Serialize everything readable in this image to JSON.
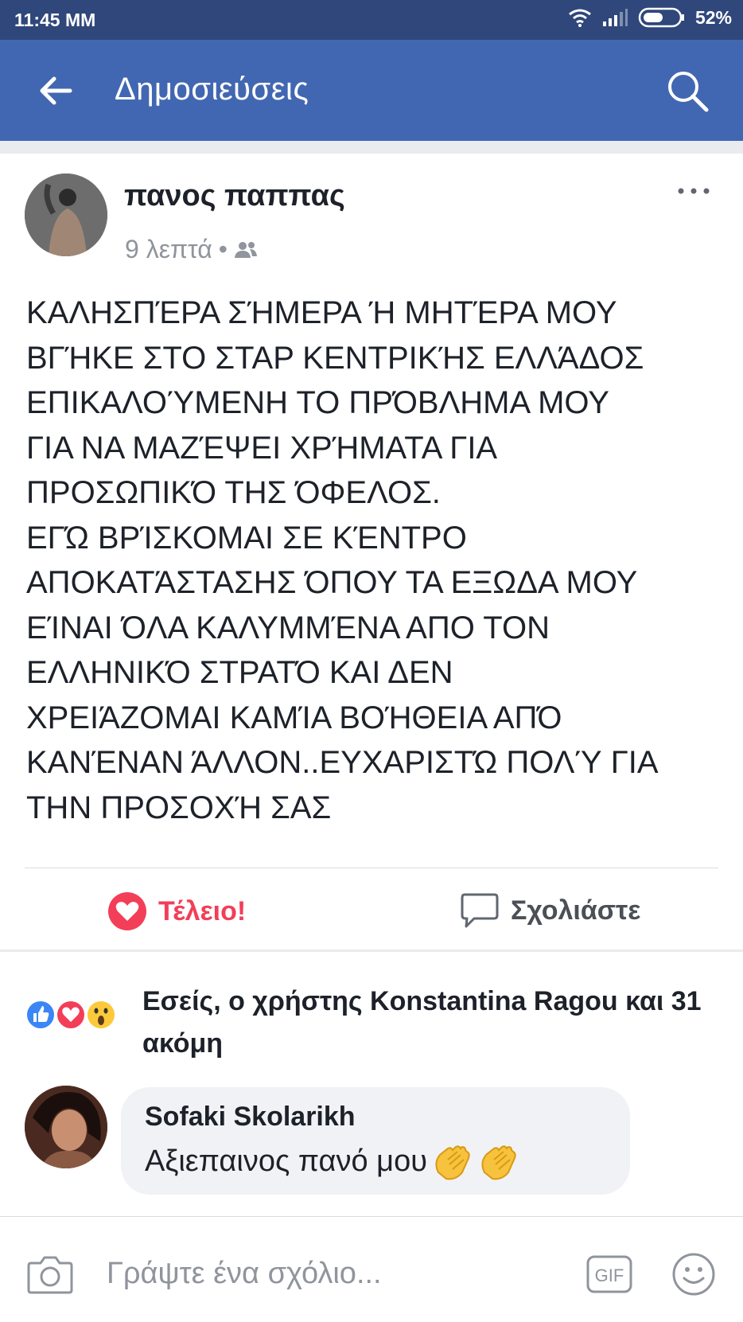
{
  "status_bar": {
    "time": "11:45 ΜΜ",
    "battery": "52%"
  },
  "header": {
    "title": "Δημοσιεύσεις"
  },
  "post": {
    "author": "πανος παππας",
    "time": "9 λεπτά",
    "separator": "•",
    "text": "ΚΑΛΗΣΠΈΡΑ ΣΉΜΕΡΑ Ή ΜΗΤΈΡΑ ΜΟΥ\nΒΓΉΚΕ ΣΤΟ ΣΤΑΡ ΚΕΝΤΡΙΚΉΣ ΕΛΛΆΔΟΣ\nΕΠΙΚΑΛΟΎΜΕΝΗ ΤΟ ΠΡΌΒΛΗΜΑ ΜΟΥ\nΓΙΑ ΝΑ ΜΑΖΈΨΕΙ ΧΡΉΜΑΤΑ ΓΙΑ\nΠΡΟΣΩΠΙΚΌ ΤΗΣ ΌΦΕΛΟΣ.\nΕΓΏ ΒΡΊΣΚΟΜΑΙ ΣΕ ΚΈΝΤΡΟ\nΑΠΟΚΑΤΆΣΤΑΣΗΣ ΌΠΟΥ ΤΑ ΕΞΩΔΑ ΜΟΥ\nΕΊΝΑΙ ΌΛΑ ΚΑΛΥΜΜΈΝΑ ΑΠΟ ΤΟΝ\nΕΛΛΗΝΙΚΌ ΣΤΡΑΤΌ ΚΑΙ ΔΕΝ\nΧΡΕΙΆΖΟΜΑΙ ΚΑΜΊΑ ΒΟΉΘΕΙΑ ΑΠΌ\nΚΑΝΈΝΑΝ ΆΛΛΟΝ..ΕΥΧΑΡΙΣΤΏ ΠΟΛΎ ΓΙΑ\nΤΗΝ ΠΡΟΣΟΧΉ ΣΑΣ"
  },
  "actions": {
    "like_label": "Τέλειο!",
    "comment_label": "Σχολιάστε"
  },
  "reactions": {
    "summary": "Εσείς, ο χρήστης Konstantina Ragou και 31 ακόμη"
  },
  "comment": {
    "author": "Sofaki Skolarikh",
    "text": "Αξιεπαινος πανό μου"
  },
  "composer": {
    "placeholder": "Γράψτε ένα σχόλιο...",
    "gif_label": "GIF"
  },
  "colors": {
    "header": "#4267b2",
    "status_bar": "#2f477a",
    "love": "#f33e58"
  }
}
